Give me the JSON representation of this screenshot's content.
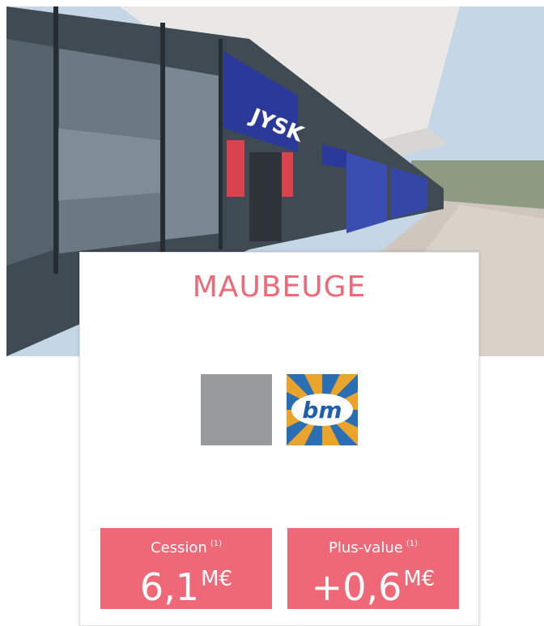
{
  "hero": {
    "sign_text": "JYSK",
    "accent_sign": "#2b3a9a"
  },
  "card": {
    "city": "MAUBEUGE",
    "brand_logo_text": "bm",
    "accent": "#ee6877",
    "stats": [
      {
        "label": "Cession",
        "footnote": "(1)",
        "value": "6,1",
        "unit": "M€"
      },
      {
        "label": "Plus-value",
        "footnote": "(1)",
        "value": "+0,6",
        "unit": "M€"
      }
    ]
  }
}
